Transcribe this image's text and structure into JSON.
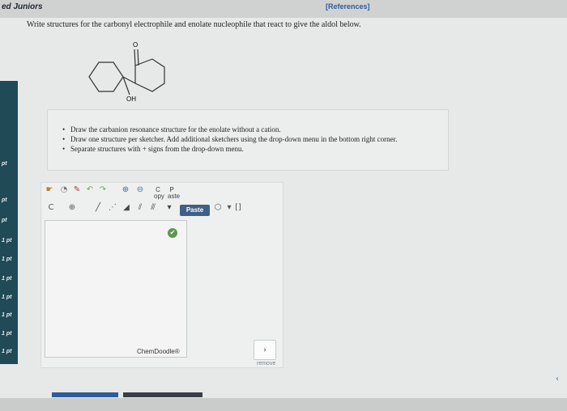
{
  "header": {
    "title": "ed Juniors",
    "references_label": "[References]"
  },
  "question": {
    "text": "Write structures for the carbonyl electrophile and enolate nucleophile that react to give the aldol below."
  },
  "molecule_labels": {
    "carbonyl": "O",
    "hydroxyl": "OH"
  },
  "instructions": [
    "Draw the carbanion resonance structure for the enolate without a cation.",
    "Draw one structure per sketcher. Add additional sketchers using the drop-down menu in the bottom right corner.",
    "Separate structures with + signs from the drop-down menu."
  ],
  "left_rail": {
    "points": [
      "pt",
      "pt",
      "pt",
      "1 pt",
      "1 pt",
      "1 pt",
      "1 pt",
      "1 pt",
      "1 pt",
      "1 pt"
    ]
  },
  "sketcher": {
    "copy_label": "C\nopy",
    "paste_tool_label": "P\naste",
    "paste_button": "Paste",
    "chemdoodle_label": "ChemDoodle®",
    "canvas_ok": "✔"
  },
  "footer": {
    "dropdown_symbol": "›",
    "remove_label": "remove",
    "next_icon": "‹"
  }
}
